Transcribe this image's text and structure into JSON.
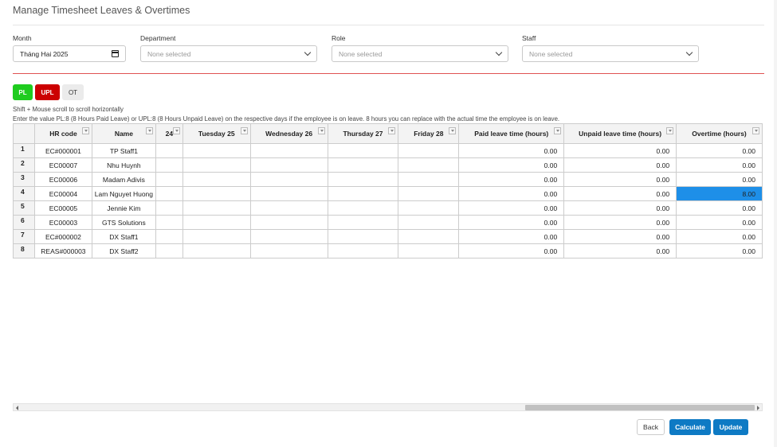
{
  "page": {
    "title": "Manage Timesheet Leaves & Overtimes"
  },
  "filters": {
    "month": {
      "label": "Month",
      "value": "Tháng Hai 2025"
    },
    "department": {
      "label": "Department",
      "placeholder": "None selected"
    },
    "role": {
      "label": "Role",
      "placeholder": "None selected"
    },
    "staff": {
      "label": "Staff",
      "placeholder": "None selected"
    }
  },
  "legend": {
    "pl": "PL",
    "upl": "UPL",
    "ot": "OT",
    "pl_color": "#1fcc1f",
    "upl_color": "#cc0000"
  },
  "hints": {
    "scroll": "Shift + Mouse scroll to scroll horizontally",
    "instructions": "Enter the value PL:8 (8 Hours Paid Leave) or UPL:8 (8 Hours Unpaid Leave) on the respective days if the employee is on leave. 8 hours you can replace with the actual time the employee is on leave."
  },
  "grid": {
    "columns": {
      "hr_code": "HR code",
      "name": "Name",
      "partial": "24",
      "tue": "Tuesday 25",
      "wed": "Wednesday 26",
      "thu": "Thursday 27",
      "fri": "Friday 28",
      "paid": "Paid leave time (hours)",
      "unpaid": "Unpaid leave time (hours)",
      "overtime": "Overtime (hours)"
    },
    "rows": [
      {
        "index": "1",
        "hr_code": "EC#000001",
        "name": "TP Staff1",
        "paid": "0.00",
        "unpaid": "0.00",
        "overtime": "0.00"
      },
      {
        "index": "2",
        "hr_code": "EC00007",
        "name": "Nhu Huynh",
        "paid": "0.00",
        "unpaid": "0.00",
        "overtime": "0.00"
      },
      {
        "index": "3",
        "hr_code": "EC00006",
        "name": "Madam Adivis",
        "paid": "0.00",
        "unpaid": "0.00",
        "overtime": "0.00"
      },
      {
        "index": "4",
        "hr_code": "EC00004",
        "name": "Lam Nguyet Huong",
        "paid": "0.00",
        "unpaid": "0.00",
        "overtime": "8.00"
      },
      {
        "index": "5",
        "hr_code": "EC00005",
        "name": "Jennie Kim",
        "paid": "0.00",
        "unpaid": "0.00",
        "overtime": "0.00"
      },
      {
        "index": "6",
        "hr_code": "EC00003",
        "name": "GTS Solutions",
        "paid": "0.00",
        "unpaid": "0.00",
        "overtime": "0.00"
      },
      {
        "index": "7",
        "hr_code": "EC#000002",
        "name": "DX Staff1",
        "paid": "0.00",
        "unpaid": "0.00",
        "overtime": "0.00"
      },
      {
        "index": "8",
        "hr_code": "REAS#000003",
        "name": "DX Staff2",
        "paid": "0.00",
        "unpaid": "0.00",
        "overtime": "0.00"
      }
    ],
    "selected_cell": {
      "row": 3,
      "column": "overtime"
    },
    "selection_color": "#1e8fe8"
  },
  "actions": {
    "back": "Back",
    "calculate": "Calculate",
    "update": "Update",
    "primary_color": "#0e7ac4"
  }
}
